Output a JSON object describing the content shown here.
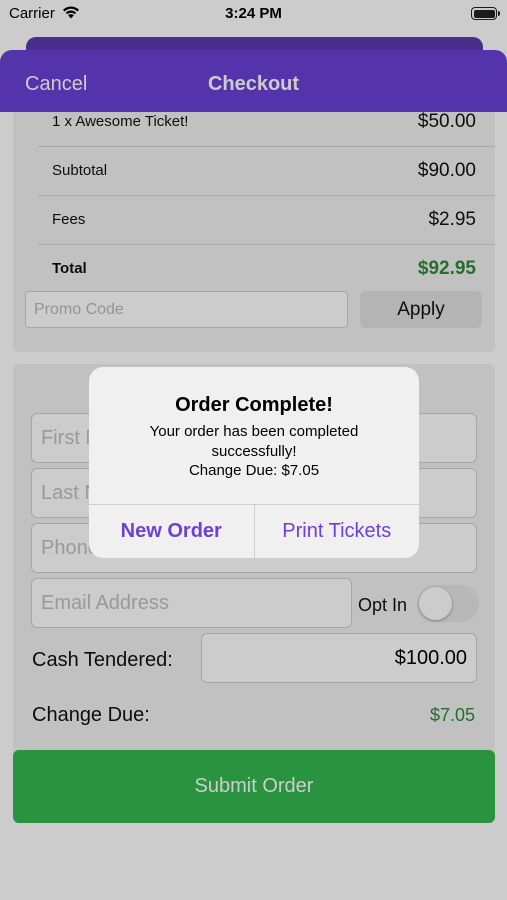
{
  "status_bar": {
    "carrier": "Carrier",
    "time": "3:24 PM"
  },
  "nav": {
    "cancel_label": "Cancel",
    "title": "Checkout"
  },
  "order_summary": {
    "rows": [
      {
        "label": "1 x Awesome Ticket!",
        "value": "$50.00"
      },
      {
        "label": "Subtotal",
        "value": "$90.00"
      },
      {
        "label": "Fees",
        "value": "$2.95"
      },
      {
        "label": "Total",
        "value": "$92.95"
      }
    ],
    "promo_placeholder": "Promo Code",
    "apply_label": "Apply"
  },
  "form": {
    "first_name_placeholder": "First Name",
    "last_name_placeholder": "Last Name",
    "phone_placeholder": "Phone Number",
    "email_placeholder": "Email Address",
    "opt_in_label": "Opt In",
    "opt_in_on": false,
    "cash_label": "Cash Tendered:",
    "cash_value": "$100.00",
    "change_label": "Change Due:",
    "change_value": "$7.05",
    "submit_label": "Submit Order"
  },
  "alert": {
    "title": "Order Complete!",
    "message_line1": "Your order has been completed",
    "message_line2": "successfully!",
    "message_line3": "Change Due: $7.05",
    "new_order_label": "New Order",
    "print_tickets_label": "Print Tickets"
  },
  "colors": {
    "accent": "#6b41d6",
    "success": "#34b851",
    "total_green": "#2e8b3a"
  }
}
